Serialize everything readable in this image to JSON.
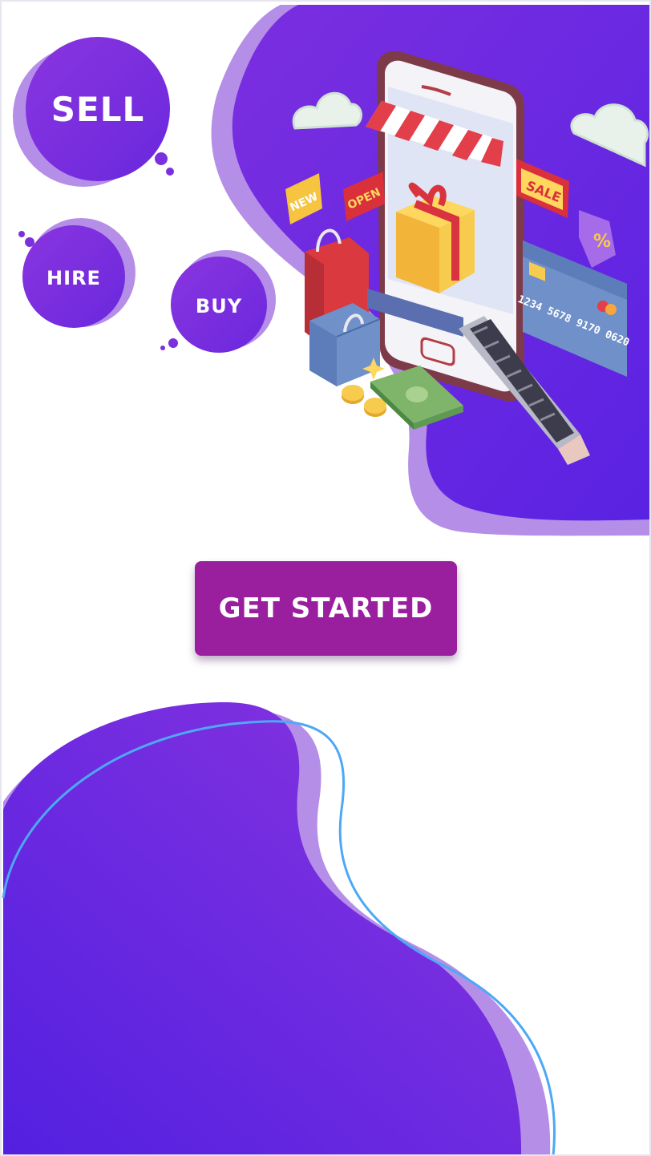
{
  "bubbles": {
    "sell": "SELL",
    "hire": "HIRE",
    "buy": "BUY"
  },
  "illustration": {
    "sign_new": "NEW",
    "sign_open": "OPEN",
    "sign_sale": "SALE",
    "percent": "%",
    "card_number": "1234 5678 9170 0620"
  },
  "cta": {
    "label": "GET STARTED"
  },
  "colors": {
    "purple_primary": "#6a2ae0",
    "purple_light": "#b58ee8",
    "button": "#9a1f9e",
    "outline_blue": "#4ea8f5"
  },
  "icons": [
    "cloud-icon",
    "gift-icon",
    "shopping-bag-icon",
    "credit-card-icon",
    "coin-icon",
    "banknote-icon",
    "escalator-icon",
    "smartphone-icon"
  ]
}
